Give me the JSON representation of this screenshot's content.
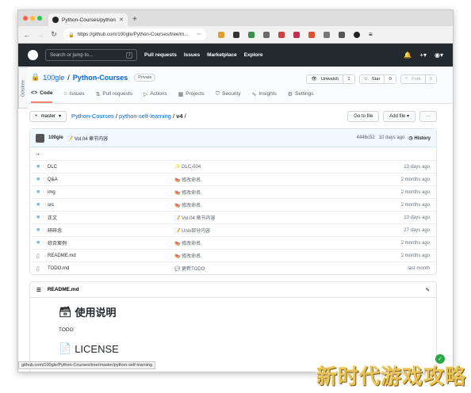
{
  "browser": {
    "tab_title": "Python-Courses/python-self-le",
    "url": "https://github.com/100gle/Python-Courses/tree/m...",
    "status_url": "github.com/100gle/Python-Courses/tree/master/python-self-learning"
  },
  "gh_header": {
    "search_placeholder": "Search or jump to...",
    "search_key": "/",
    "nav": [
      "Pull requests",
      "Issues",
      "Marketplace",
      "Explore"
    ]
  },
  "sidetab": "Octotree",
  "repo": {
    "owner": "100gle",
    "separator": "/",
    "name": "Python-Courses",
    "visibility": "Private",
    "unwatch": "Unwatch",
    "unwatch_count": "1",
    "star": "Star",
    "star_count": "0",
    "fork": "Fork",
    "fork_count": "0",
    "tabs": [
      {
        "label": "Code",
        "icon": "<>"
      },
      {
        "label": "Issues",
        "icon": "○"
      },
      {
        "label": "Pull requests",
        "icon": "⇅"
      },
      {
        "label": "Actions",
        "icon": "▷"
      },
      {
        "label": "Projects",
        "icon": "▦"
      },
      {
        "label": "Security",
        "icon": "⛉"
      },
      {
        "label": "Insights",
        "icon": "∿"
      },
      {
        "label": "Settings",
        "icon": "⚙"
      }
    ]
  },
  "filenav": {
    "branch": "master",
    "crumb_repo": "Python-Courses",
    "crumb_sub": "python-self-learning",
    "crumb_current": "v4",
    "sep": "/",
    "goto": "Go to file",
    "add": "Add file",
    "more": "···"
  },
  "commit": {
    "author": "100gle",
    "message": "📝 Vol.04 章节内容",
    "sha": "4446c52",
    "age": "10 days ago",
    "history": "History"
  },
  "files": [
    {
      "name": "..",
      "type": "up",
      "msg": "",
      "age": ""
    },
    {
      "name": "DLC",
      "type": "dir",
      "msg": "✨ DLC-004",
      "age": "13 days ago"
    },
    {
      "name": "Q&A",
      "type": "dir",
      "msg": "🍉 修改命名",
      "age": "2 months ago"
    },
    {
      "name": "img",
      "type": "dir",
      "msg": "🍉 修改命名",
      "age": "2 months ago"
    },
    {
      "name": "src",
      "type": "dir",
      "msg": "🍉 修改命名",
      "age": "2 months ago"
    },
    {
      "name": "正文",
      "type": "dir",
      "msg": "📝 Vol.04 章节内容",
      "age": "10 days ago"
    },
    {
      "name": "碎碎念",
      "type": "dir",
      "msg": "📝 Unix部分内容",
      "age": "27 days ago"
    },
    {
      "name": "综合案例",
      "type": "dir",
      "msg": "🍉 修改命名",
      "age": "2 months ago"
    },
    {
      "name": "README.md",
      "type": "file",
      "msg": "🍉 修改命名",
      "age": "2 months ago"
    },
    {
      "name": "TODO.md",
      "type": "file",
      "msg": "💬 更新TODO",
      "age": "last month"
    }
  ],
  "readme": {
    "filename": "README.md",
    "heading": "使用说明",
    "heading_icon": "🗃",
    "text": "TODO",
    "heading2": "LICENSE",
    "heading2_icon": "📄"
  },
  "watermark": "新时代游戏攻略",
  "colors": {
    "accent": "#0366d6",
    "header": "#24292e",
    "active_tab": "#f9826c"
  }
}
